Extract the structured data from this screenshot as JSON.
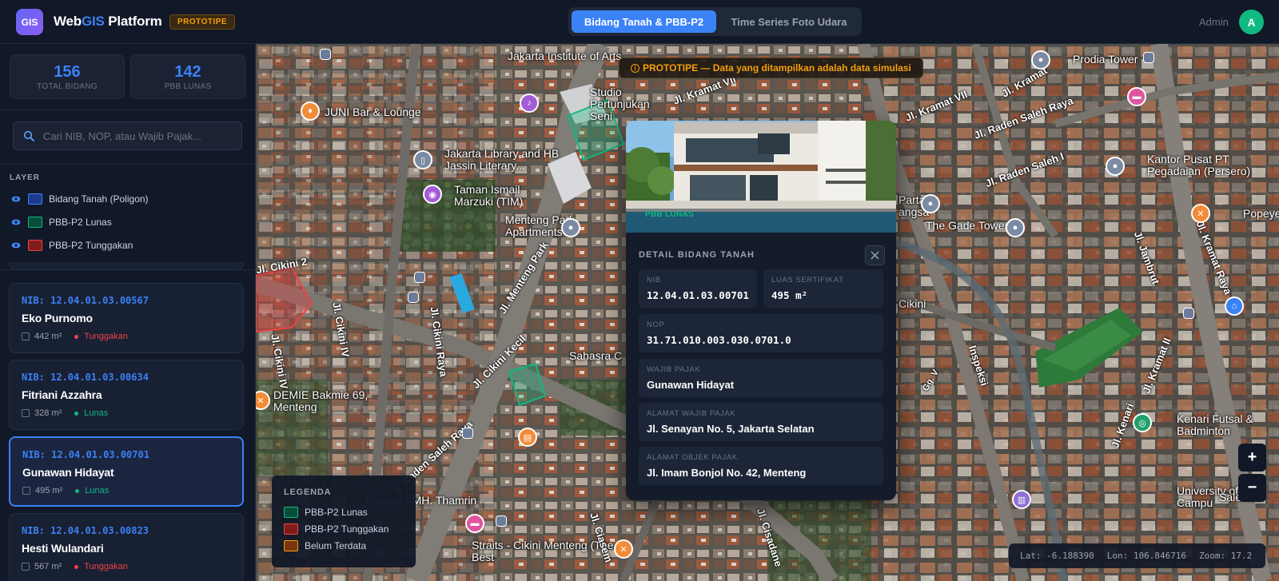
{
  "app": {
    "logo_text": "GIS",
    "title_prefix": "Web",
    "title_accent": "GIS",
    "title_suffix": " Platform",
    "badge": "PROTOTIPE"
  },
  "tabs": [
    {
      "label": "Bidang Tanah & PBB-P2",
      "active": true
    },
    {
      "label": "Time Series Foto Udara",
      "active": false
    }
  ],
  "user": {
    "name": "Admin",
    "initial": "A"
  },
  "stats": [
    {
      "value": "156",
      "label": "TOTAL BIDANG"
    },
    {
      "value": "142",
      "label": "PBB LUNAS"
    }
  ],
  "search": {
    "placeholder": "Cari NIB, NOP, atau Wajib Pajak..."
  },
  "layers": {
    "title": "LAYER",
    "items": [
      {
        "label": "Bidang Tanah (Poligon)",
        "color": "#3b82f6"
      },
      {
        "label": "PBB-P2 Lunas",
        "color": "#10b981"
      },
      {
        "label": "PBB-P2 Tunggakan",
        "color": "#ef4444"
      }
    ]
  },
  "parcels": [
    {
      "nib": "NIB: 12.04.01.03.00567",
      "owner": "Eko Purnomo",
      "area": "442 m²",
      "status": "Tunggakan",
      "status_color": "#ef4444"
    },
    {
      "nib": "NIB: 12.04.01.03.00634",
      "owner": "Fitriani Azzahra",
      "area": "328 m²",
      "status": "Lunas",
      "status_color": "#10b981"
    },
    {
      "nib": "NIB: 12.04.01.03.00701",
      "owner": "Gunawan Hidayat",
      "area": "495 m²",
      "status": "Lunas",
      "status_color": "#10b981",
      "selected": true
    },
    {
      "nib": "NIB: 12.04.01.03.00823",
      "owner": "Hesti Wulandari",
      "area": "567 m²",
      "status": "Tunggakan",
      "status_color": "#ef4444"
    }
  ],
  "map": {
    "banner_icon": "i",
    "banner": "PROTOTIPE — Data yang ditampilkan adalah data simulasi",
    "labels": {
      "jakarta_institute": "Jakarta Institute of Arts",
      "juni_bar": "JUNI Bar & Lounge",
      "jakarta_library": "Jakarta Library and HB Jassin Literary...",
      "taman_ismail": "Taman Ismail Marzuki (TIM)",
      "menteng_park": "Menteng Park Apartments",
      "studio": "Studio Pertunjukan Seni",
      "prodia": "Prodia Tower",
      "kantor_pusat": "Kantor Pusat PT Pegadaian (Persero)",
      "gade_tower": "The Gade Tower",
      "partai": "Partai angsa",
      "sahasra": "Sahasra C",
      "demie": "DEMIE Bakmie 69, Menteng",
      "cikini": "Cikini",
      "kenari": "Kenari Futsal & Badminton",
      "museum": "Museum MH. Thamrin",
      "straits": "Straits - Cikini Menteng (The Best",
      "university": "University of Campu",
      "salemba": "Salemba",
      "popeye": "Popeye"
    },
    "roads": {
      "cikini2": "Jl. Cikini 2",
      "cikini4a": "Jl. Cikini IV",
      "cikini4b": "Jl. Cikini IV",
      "cikini_raya": "Jl. Cikini Raya",
      "cikini_kecil": "Jl. Cikini Kecil",
      "menteng_park": "Jl. Menteng Park",
      "raden_saleh_raya": "Jl. Raden Saleh Raya",
      "raden_saleh_raya2": "Jl. Raden Saleh Raya",
      "raden_saleh_1": "Jl. Raden Saleh I",
      "raden_saleh_1b": "Jl. Raden Saleh I",
      "kramat_vii": "Jl. Kramat VII",
      "kramat_raya": "Jl. Kramat Raya",
      "kramat_2": "Jl. Kramat II",
      "kramat": "Jl. Kramat",
      "jambrut": "Jl. Jambrut",
      "kenari": "Jl. Kenari",
      "inspeksi": "Inspeksi",
      "ciasem": "Jl. Ciasem",
      "cisadane": "Jl. Cisadane",
      "kramat_vii_top": "Jl. Kramat VII",
      "gg": "Gg. V",
      "cikini_tiny": "Cikini"
    },
    "legend": {
      "title": "LEGENDA",
      "items": [
        {
          "label": "PBB-P2 Lunas",
          "color": "#10b981"
        },
        {
          "label": "PBB-P2 Tunggakan",
          "color": "#ef4444"
        },
        {
          "label": "Belum Terdata",
          "color": "#f59e0b"
        }
      ]
    },
    "zoom": {
      "in": "+",
      "out": "−"
    },
    "coords": {
      "lat": "Lat: -6.188390",
      "lon": "Lon: 106.846716",
      "zoom": "Zoom: 17.2"
    }
  },
  "detail": {
    "photo_badge": "PBB LUNAS",
    "title": "DETAIL BIDANG TANAH",
    "fields": {
      "nib": {
        "label": "NIB",
        "value": "12.04.01.03.00701"
      },
      "luas": {
        "label": "LUAS SERTIFIKAT",
        "value": "495 m²"
      },
      "nop": {
        "label": "NOP",
        "value": "31.71.010.003.030.0701.0"
      },
      "wajib_pajak": {
        "label": "WAJIB PAJAK",
        "value": "Gunawan Hidayat"
      },
      "alamat_wp": {
        "label": "ALAMAT WAJIB PAJAK",
        "value": "Jl. Senayan No. 5, Jakarta Selatan"
      },
      "alamat_op": {
        "label": "ALAMAT OBJEK PAJAK",
        "value": "Jl. Imam Bonjol No. 42, Menteng"
      }
    }
  }
}
